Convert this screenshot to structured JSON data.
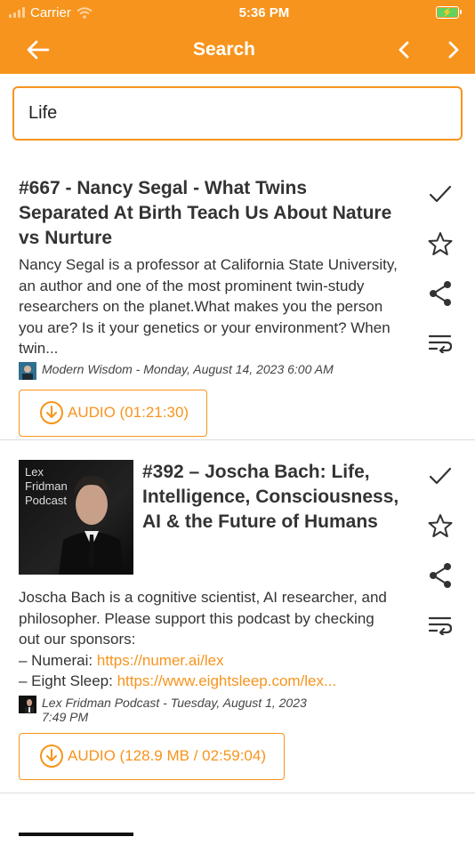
{
  "status": {
    "carrier": "Carrier",
    "time": "5:36 PM"
  },
  "nav": {
    "title": "Search"
  },
  "search": {
    "value": "Life"
  },
  "items": [
    {
      "title": "#667 - Nancy Segal - What Twins Separated At Birth Teach Us About Nature vs Nurture",
      "description": "Nancy Segal is a professor at California State University, an author and one of the most prominent twin-study researchers on the planet.What makes you the person you are? Is it your genetics or your environment? When twin...",
      "meta": "Modern Wisdom - Monday, August 14, 2023 6:00 AM",
      "audio": "AUDIO (01:21:30)"
    },
    {
      "title": "#392 – Joscha Bach: Life, Intelligence, Consciousness, AI & the Future of Humans",
      "description_lines": [
        "Joscha Bach is a cognitive scientist, AI researcher, and philosopher. Please support this podcast by checking out our sponsors:",
        "– Numerai: ",
        "– Eight Sleep: "
      ],
      "links": [
        "https://numer.ai/lex",
        "https://www.eightsleep.com/lex..."
      ],
      "cover_text": "Lex Fridman Podcast",
      "meta_line1": "Lex Fridman Podcast - Tuesday, August 1, 2023",
      "meta_line2": "7:49 PM",
      "audio": "AUDIO (128.9 MB / 02:59:04)"
    }
  ],
  "colors": {
    "accent": "#f7941d"
  }
}
